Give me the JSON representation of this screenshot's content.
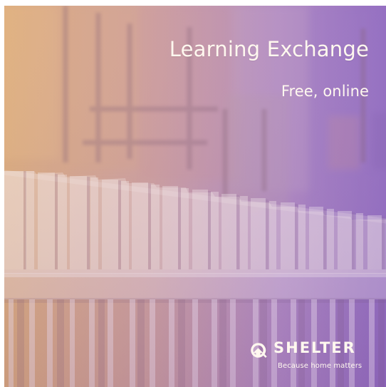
{
  "artwork": {
    "headline": "Learning Exchange",
    "subheadline": "Free, online"
  },
  "brand": {
    "name": "SHELTER",
    "tagline": "Because home matters",
    "logo_icon": "shelter-logo-icon"
  },
  "colors": {
    "text": "#fff8ef",
    "gradient_left": "#d8a77c",
    "gradient_center": "#cb9d9a",
    "gradient_right": "#8f68be"
  }
}
